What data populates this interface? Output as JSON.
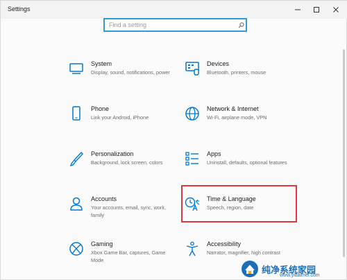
{
  "window": {
    "title": "Settings"
  },
  "search": {
    "placeholder": "Find a setting"
  },
  "tiles": [
    {
      "name": "System",
      "desc": "Display, sound, notifications, power",
      "icon": "monitor-icon"
    },
    {
      "name": "Devices",
      "desc": "Bluetooth, printers, mouse",
      "icon": "devices-icon"
    },
    {
      "name": "Phone",
      "desc": "Link your Android, iPhone",
      "icon": "phone-icon"
    },
    {
      "name": "Network & Internet",
      "desc": "Wi-Fi, airplane mode, VPN",
      "icon": "globe-icon"
    },
    {
      "name": "Personalization",
      "desc": "Background, lock screen, colors",
      "icon": "brush-icon"
    },
    {
      "name": "Apps",
      "desc": "Uninstall, defaults, optional features",
      "icon": "apps-list-icon"
    },
    {
      "name": "Accounts",
      "desc": "Your accounts, email, sync, work, family",
      "icon": "person-icon"
    },
    {
      "name": "Time & Language",
      "desc": "Speech, region, date",
      "icon": "time-language-icon"
    },
    {
      "name": "Gaming",
      "desc": "Xbox Game Bar, captures, Game Mode",
      "icon": "xbox-icon"
    },
    {
      "name": "Accessibility",
      "desc": "Narrator, magnifier, high contrast",
      "icon": "accessibility-icon"
    }
  ],
  "watermark": {
    "text": "纯净系统家园",
    "url": "www.yidaimei.com"
  },
  "colors": {
    "accent": "#0078d4",
    "highlight": "#e0383b",
    "search_border": "#2e9cd7"
  }
}
